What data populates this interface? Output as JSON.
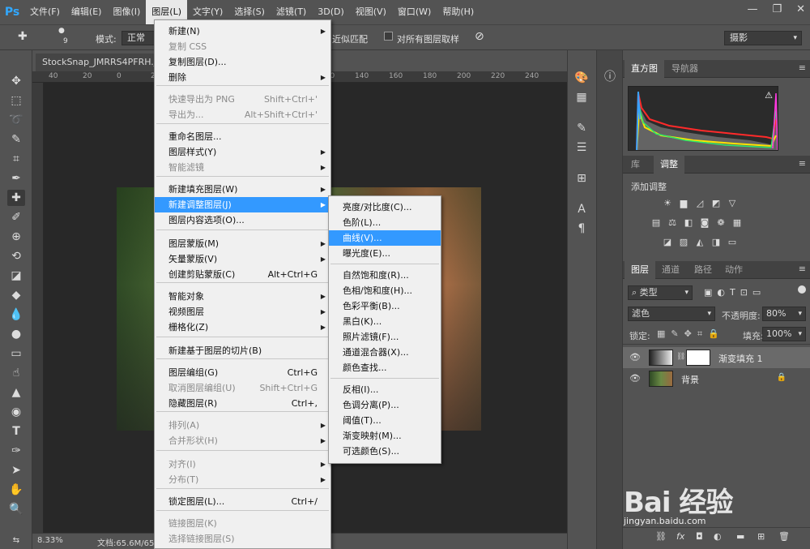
{
  "menubar": {
    "logo": "Ps",
    "items": [
      "文件(F)",
      "编辑(E)",
      "图像(I)",
      "图层(L)",
      "文字(Y)",
      "选择(S)",
      "滤镜(T)",
      "3D(D)",
      "视图(V)",
      "窗口(W)",
      "帮助(H)"
    ],
    "active_index": 3,
    "win_minimize": "—",
    "win_restore": "❐",
    "win_close": "✕"
  },
  "options": {
    "brush_size": "9",
    "mode_label": "模式:",
    "mode_value": "正常",
    "proximity_match": "近似匹配",
    "sample_all": "对所有图层取样",
    "workspace": "摄影"
  },
  "document": {
    "tab_name": "StockSnap_JMRRS4PFRH.jpg",
    "ruler_numbers": [
      "40",
      "20",
      "0",
      "20",
      "40",
      "60",
      "80",
      "100",
      "120",
      "140",
      "160",
      "180",
      "200",
      "220",
      "240"
    ],
    "zoom": "8.33%",
    "doc_info": "文档:65.6M/65"
  },
  "layer_menu": {
    "items": [
      {
        "label": "新建(N)",
        "shortcut": "",
        "submenu": true,
        "disabled": false
      },
      {
        "label": "复制 CSS",
        "shortcut": "",
        "submenu": false,
        "disabled": true
      },
      {
        "label": "复制图层(D)...",
        "shortcut": "",
        "submenu": false,
        "disabled": false
      },
      {
        "label": "删除",
        "shortcut": "",
        "submenu": true,
        "disabled": false
      },
      {
        "label": "快速导出为 PNG",
        "shortcut": "Shift+Ctrl+'",
        "submenu": false,
        "disabled": true
      },
      {
        "label": "导出为...",
        "shortcut": "Alt+Shift+Ctrl+'",
        "submenu": false,
        "disabled": true
      },
      {
        "label": "重命名图层...",
        "shortcut": "",
        "submenu": false,
        "disabled": false
      },
      {
        "label": "图层样式(Y)",
        "shortcut": "",
        "submenu": true,
        "disabled": false
      },
      {
        "label": "智能滤镜",
        "shortcut": "",
        "submenu": true,
        "disabled": true
      },
      {
        "label": "新建填充图层(W)",
        "shortcut": "",
        "submenu": true,
        "disabled": false
      },
      {
        "label": "新建调整图层(J)",
        "shortcut": "",
        "submenu": true,
        "disabled": false
      },
      {
        "label": "图层内容选项(O)...",
        "shortcut": "",
        "submenu": false,
        "disabled": false
      },
      {
        "label": "图层蒙版(M)",
        "shortcut": "",
        "submenu": true,
        "disabled": false
      },
      {
        "label": "矢量蒙版(V)",
        "shortcut": "",
        "submenu": true,
        "disabled": false
      },
      {
        "label": "创建剪贴蒙版(C)",
        "shortcut": "Alt+Ctrl+G",
        "submenu": false,
        "disabled": false
      },
      {
        "label": "智能对象",
        "shortcut": "",
        "submenu": true,
        "disabled": false
      },
      {
        "label": "视频图层",
        "shortcut": "",
        "submenu": true,
        "disabled": false
      },
      {
        "label": "栅格化(Z)",
        "shortcut": "",
        "submenu": true,
        "disabled": false
      },
      {
        "label": "新建基于图层的切片(B)",
        "shortcut": "",
        "submenu": false,
        "disabled": false
      },
      {
        "label": "图层编组(G)",
        "shortcut": "Ctrl+G",
        "submenu": false,
        "disabled": false
      },
      {
        "label": "取消图层编组(U)",
        "shortcut": "Shift+Ctrl+G",
        "submenu": false,
        "disabled": true
      },
      {
        "label": "隐藏图层(R)",
        "shortcut": "Ctrl+,",
        "submenu": false,
        "disabled": false
      },
      {
        "label": "排列(A)",
        "shortcut": "",
        "submenu": true,
        "disabled": true
      },
      {
        "label": "合并形状(H)",
        "shortcut": "",
        "submenu": true,
        "disabled": true
      },
      {
        "label": "对齐(I)",
        "shortcut": "",
        "submenu": true,
        "disabled": true
      },
      {
        "label": "分布(T)",
        "shortcut": "",
        "submenu": true,
        "disabled": true
      },
      {
        "label": "锁定图层(L)...",
        "shortcut": "Ctrl+/",
        "submenu": false,
        "disabled": false
      },
      {
        "label": "链接图层(K)",
        "shortcut": "",
        "submenu": false,
        "disabled": true
      },
      {
        "label": "选择链接图层(S)",
        "shortcut": "",
        "submenu": false,
        "disabled": true
      }
    ]
  },
  "adjust_submenu": {
    "items": [
      {
        "label": "亮度/对比度(C)..."
      },
      {
        "label": "色阶(L)..."
      },
      {
        "label": "曲线(V)..."
      },
      {
        "label": "曝光度(E)..."
      },
      {
        "label": "自然饱和度(R)..."
      },
      {
        "label": "色相/饱和度(H)..."
      },
      {
        "label": "色彩平衡(B)..."
      },
      {
        "label": "黑白(K)..."
      },
      {
        "label": "照片滤镜(F)..."
      },
      {
        "label": "通道混合器(X)..."
      },
      {
        "label": "颜色查找..."
      },
      {
        "label": "反相(I)..."
      },
      {
        "label": "色调分离(P)..."
      },
      {
        "label": "阈值(T)..."
      },
      {
        "label": "渐变映射(M)..."
      },
      {
        "label": "可选颜色(S)..."
      }
    ],
    "highlight_index": 2
  },
  "panels": {
    "histogram_tab": "直方图",
    "navigator_tab": "导航器",
    "library_tab": "库",
    "adjust_tab": "调整",
    "adjust_title": "添加调整",
    "layers_tab": "图层",
    "channels_tab": "通道",
    "paths_tab": "路径",
    "actions_tab": "动作",
    "filter_kind": "类型",
    "blend_mode": "滤色",
    "opacity_label": "不透明度:",
    "opacity_value": "80%",
    "lock_label": "锁定:",
    "fill_label": "填充:",
    "fill_value": "100%",
    "layers": [
      {
        "name": "渐变填充 1"
      },
      {
        "name": "背景"
      }
    ],
    "footer_fx": "fx"
  },
  "watermark": {
    "text": "Bai 经验",
    "url": "jingyan.baidu.com"
  },
  "colors": {
    "highlight": "#3399ff",
    "chrome": "#535353",
    "canvas": "#282828"
  }
}
